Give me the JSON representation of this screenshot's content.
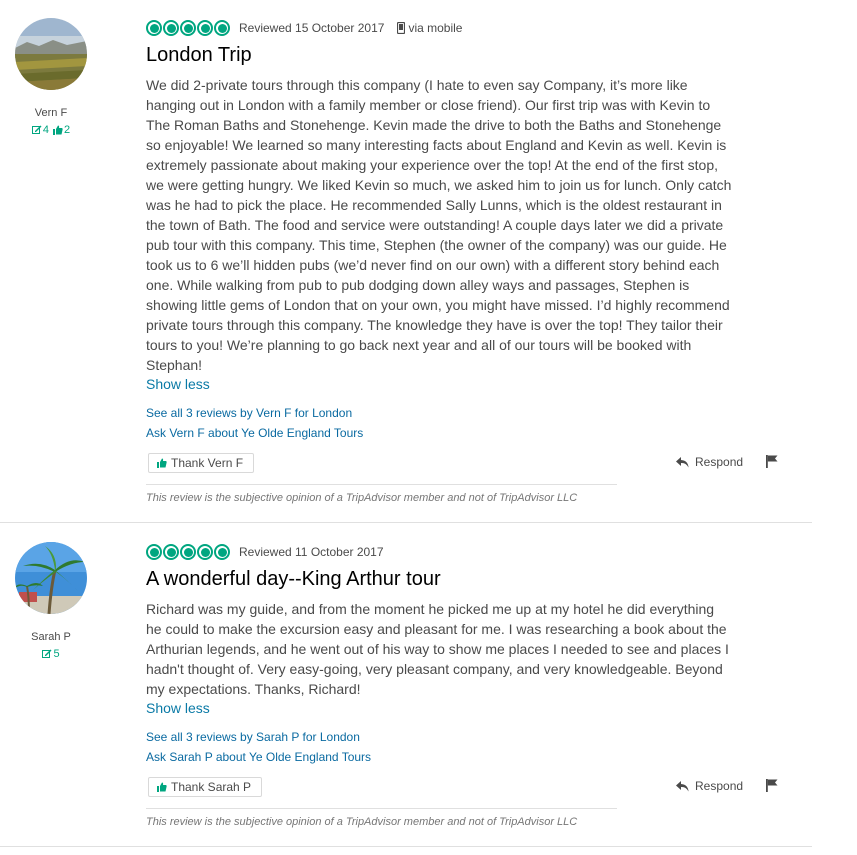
{
  "colors": {
    "accent": "#00a680",
    "link": "#0a6aa1",
    "text": "#4a4a4a"
  },
  "reviews": [
    {
      "user": {
        "name": "Vern F",
        "contributions": "4",
        "helpful_votes": "2"
      },
      "rating_bubbles": 5,
      "date": "Reviewed 15 October 2017",
      "via": "via mobile",
      "title": "London Trip",
      "lines": [
        "We did 2-private tours through this company (I hate to even say Company, it’s more like",
        "hanging out in London with a family member or close friend). Our first trip was with Kevin to",
        "The Roman Baths and Stonehenge. Kevin made the drive to both the Baths and Stonehenge",
        "so enjoyable! We learned so many interesting facts about England and Kevin as well. Kevin is",
        "extremely passionate about making your experience over the top! At the end of the first stop,",
        "we were getting hungry. We liked Kevin so much, we asked him to join us for lunch. Only catch",
        "was he had to pick the place. He recommended Sally Lunns, which is the oldest restaurant in",
        "the town of Bath. The food and service were outstanding! A couple days later we did a private",
        "pub tour with this company. This time, Stephen (the owner of the company) was our guide. He",
        "took us to 6 we’ll hidden pubs (we’d never find on our own) with a different story behind each",
        "one. While walking from pub to pub dodging down alley ways and passages, Stephen is",
        "showing little gems of London that on your own, you might have missed. I’d highly recommend",
        "private tours through this company. The knowledge they have is over the top! They tailor their",
        "tours to you! We’re planning to go back next year and all of our tours will be booked with",
        "Stephan!"
      ],
      "show_less": "Show less",
      "see_all": "See all 3 reviews by Vern F for London",
      "ask": "Ask Vern F about Ye Olde England Tours",
      "thank": "Thank Vern F",
      "respond": "Respond",
      "disclaimer": "This review is the subjective opinion of a TripAdvisor member and not of TripAdvisor LLC"
    },
    {
      "user": {
        "name": "Sarah P",
        "contributions": "5"
      },
      "rating_bubbles": 5,
      "date": "Reviewed 11 October 2017",
      "title": "A wonderful day--King Arthur tour",
      "lines": [
        "Richard was my guide, and from the moment he picked me up at my hotel he did everything",
        "he could to make the excursion easy and pleasant for me. I was researching a book about the",
        "Arthurian legends, and he went out of his way to show me places I needed to see and places I",
        "hadn't thought of. Very easy-going, very pleasant company, and very knowledgeable. Beyond",
        "my expectations. Thanks, Richard!"
      ],
      "show_less": "Show less",
      "see_all": "See all 3 reviews by Sarah P for London",
      "ask": "Ask Sarah P about Ye Olde England Tours",
      "thank": "Thank Sarah P",
      "respond": "Respond",
      "disclaimer": "This review is the subjective opinion of a TripAdvisor member and not of TripAdvisor LLC"
    }
  ]
}
